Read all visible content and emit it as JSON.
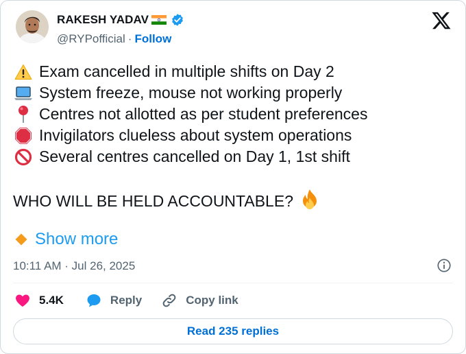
{
  "author": {
    "name": "RAKESH YADAV",
    "handle": "@RYPofficial",
    "separator": "·",
    "follow_label": "Follow"
  },
  "tweet": {
    "lines": [
      {
        "icon": "warning-icon",
        "text": "Exam cancelled in multiple shifts on Day 2"
      },
      {
        "icon": "laptop-icon",
        "text": "System freeze, mouse not working properly"
      },
      {
        "icon": "pushpin-icon",
        "text": "Centres not allotted as per student preferences"
      },
      {
        "icon": "stop-sign-icon",
        "text": "Invigilators clueless about system operations"
      },
      {
        "icon": "prohibited-icon",
        "text": "Several centres cancelled on Day 1, 1st shift"
      }
    ],
    "shout": "WHO WILL BE HELD ACCOUNTABLE?",
    "shout_icon": "fire-icon",
    "show_more": "Show more",
    "timestamp": "10:11 AM · Jul 26, 2025"
  },
  "actions": {
    "likes": "5.4K",
    "reply_label": "Reply",
    "copy_link_label": "Copy link"
  },
  "footer": {
    "read_replies": "Read 235 replies"
  },
  "colors": {
    "link": "#006fd6",
    "accent_blue": "#1d9bf0",
    "like_pink": "#f91880",
    "muted": "#536471",
    "border": "#cfd9de"
  }
}
